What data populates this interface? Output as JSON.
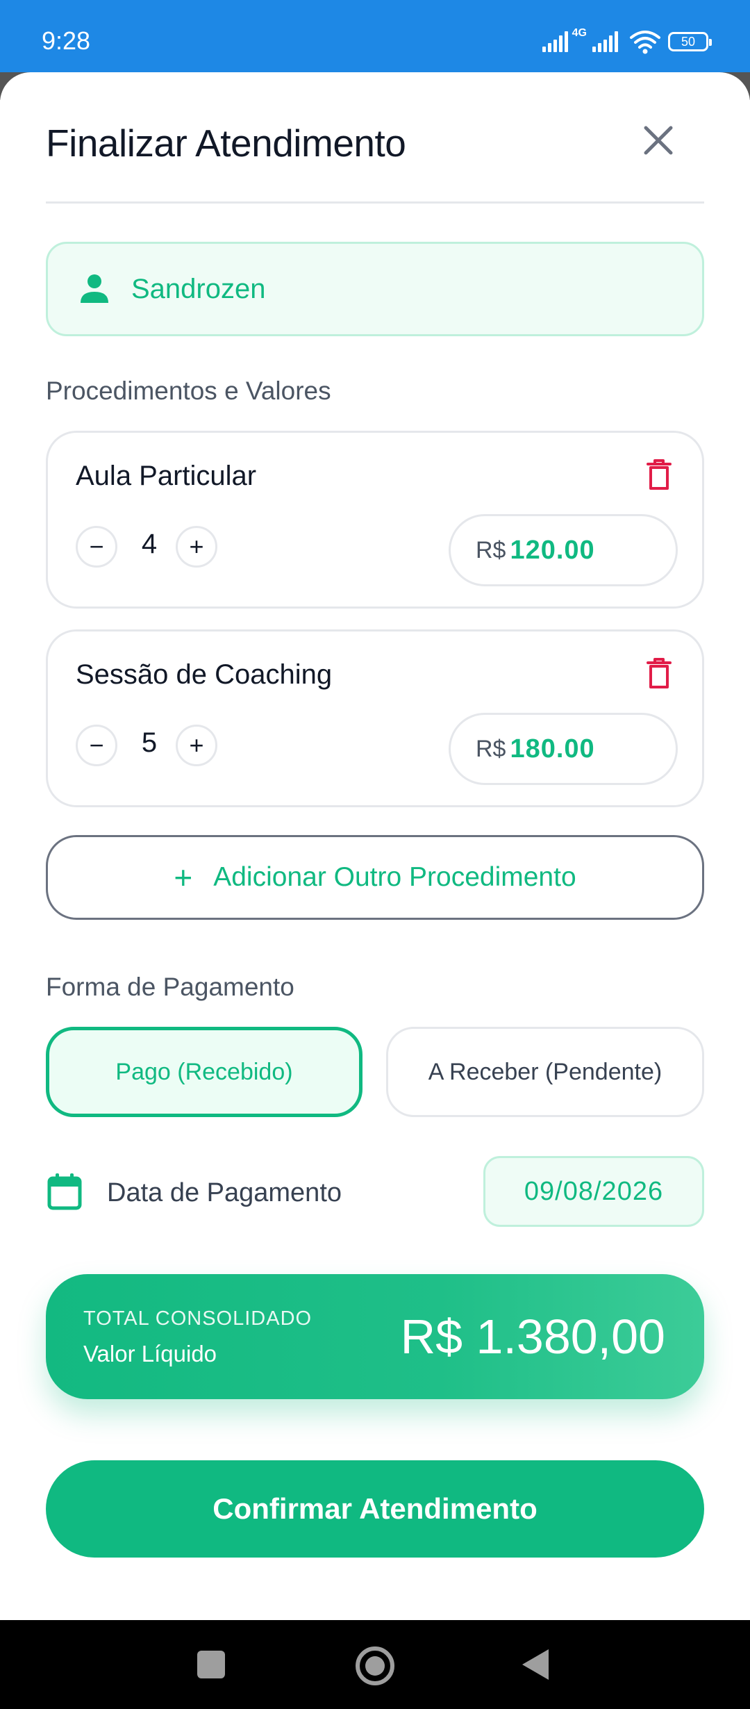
{
  "status_bar": {
    "time": "9:28",
    "network": "4G",
    "battery": "50"
  },
  "header": {
    "title": "Finalizar Atendimento"
  },
  "client": {
    "name": "Sandrozen"
  },
  "procedures_section": {
    "label": "Procedimentos e Valores"
  },
  "procedures": [
    {
      "name": "Aula Particular",
      "quantity": "4",
      "currency": "R$",
      "value": "120.00"
    },
    {
      "name": "Sessão de Coaching",
      "quantity": "5",
      "currency": "R$",
      "value": "180.00"
    }
  ],
  "add_procedure": {
    "icon": "+",
    "label": "Adicionar Outro Procedimento"
  },
  "payment_section": {
    "label": "Forma de Pagamento"
  },
  "payment_options": {
    "paid": "Pago (Recebido)",
    "pending": "A Receber (Pendente)",
    "selected": "paid"
  },
  "payment_date": {
    "label": "Data de Pagamento",
    "value": "09/08/2026"
  },
  "total": {
    "heading": "TOTAL CONSOLIDADO",
    "subheading": "Valor Líquido",
    "amount": "R$ 1.380,00"
  },
  "confirm_button": {
    "label": "Confirmar Atendimento"
  },
  "colors": {
    "accent": "#10b981",
    "status_bar": "#1e88e5",
    "danger": "#e11d48"
  }
}
